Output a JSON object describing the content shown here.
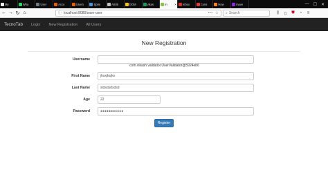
{
  "browser": {
    "tabs": [
      {
        "title": "My",
        "color": "#f0f0f0",
        "active": false
      },
      {
        "title": "Wha",
        "color": "#25d366",
        "active": false
      },
      {
        "title": "User",
        "color": "#6f7a8a",
        "active": false
      },
      {
        "title": "Acco",
        "color": "#e66000",
        "active": false
      },
      {
        "title": "Usern",
        "color": "#e66000",
        "active": false
      },
      {
        "title": "Sprin",
        "color": "#4a90d9",
        "active": false
      },
      {
        "title": "Attrib",
        "color": "#c0c0c0",
        "active": false
      },
      {
        "title": "DOM",
        "color": "#f4c20d",
        "active": false
      },
      {
        "title": "vikas",
        "color": "#0f9d58",
        "active": false
      },
      {
        "title": "In",
        "color": "#8bc34a",
        "active": true
      },
      {
        "title": "Inbox",
        "color": "#d93025",
        "active": false
      },
      {
        "title": "Cons",
        "color": "#e53935",
        "active": false
      },
      {
        "title": "How",
        "color": "#f48024",
        "active": false
      },
      {
        "title": "mave",
        "color": "#8a2be2",
        "active": false
      }
    ],
    "url": "localhost:8080/save-user",
    "search_placeholder": "Search"
  },
  "app": {
    "brand": "TecnoTab",
    "nav_links": [
      "Login",
      "New Registration",
      "All Users"
    ]
  },
  "form": {
    "title": "New Registration",
    "username_label": "Username",
    "username_value": "",
    "error_message": "com.vikash.validator.UserValidator@5924eb6",
    "first_name_label": "First Name",
    "first_name_value": "jhsxjksjkn",
    "last_name_label": "Last Name",
    "last_name_value": "sldsdsdsdsd",
    "age_label": "Age",
    "age_value": "22",
    "password_label": "Password",
    "password_value": "●●●●●●●●●●●",
    "register_label": "Register"
  }
}
